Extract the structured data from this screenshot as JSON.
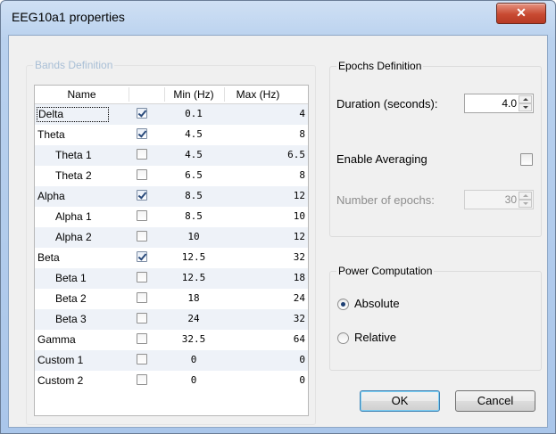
{
  "window": {
    "title": "EEG10a1 properties",
    "close_glyph": "✕"
  },
  "bands": {
    "group_label": "Bands Definition",
    "columns": {
      "name": "Name",
      "min": "Min (Hz)",
      "max": "Max (Hz)"
    },
    "rows": [
      {
        "name": "Delta",
        "checked": true,
        "min": "0.1",
        "max": "4",
        "sub": false
      },
      {
        "name": "Theta",
        "checked": true,
        "min": "4.5",
        "max": "8",
        "sub": false
      },
      {
        "name": "Theta 1",
        "checked": false,
        "min": "4.5",
        "max": "6.5",
        "sub": true
      },
      {
        "name": "Theta 2",
        "checked": false,
        "min": "6.5",
        "max": "8",
        "sub": true
      },
      {
        "name": "Alpha",
        "checked": true,
        "min": "8.5",
        "max": "12",
        "sub": false
      },
      {
        "name": "Alpha 1",
        "checked": false,
        "min": "8.5",
        "max": "10",
        "sub": true
      },
      {
        "name": "Alpha 2",
        "checked": false,
        "min": "10",
        "max": "12",
        "sub": true
      },
      {
        "name": "Beta",
        "checked": true,
        "min": "12.5",
        "max": "32",
        "sub": false
      },
      {
        "name": "Beta 1",
        "checked": false,
        "min": "12.5",
        "max": "18",
        "sub": true
      },
      {
        "name": "Beta 2",
        "checked": false,
        "min": "18",
        "max": "24",
        "sub": true
      },
      {
        "name": "Beta 3",
        "checked": false,
        "min": "24",
        "max": "32",
        "sub": true
      },
      {
        "name": "Gamma",
        "checked": false,
        "min": "32.5",
        "max": "64",
        "sub": false
      },
      {
        "name": "Custom 1",
        "checked": false,
        "min": "0",
        "max": "0",
        "sub": false
      },
      {
        "name": "Custom 2",
        "checked": false,
        "min": "0",
        "max": "0",
        "sub": false
      }
    ]
  },
  "epochs": {
    "group_label": "Epochs Definition",
    "duration_label": "Duration (seconds):",
    "duration_value": "4.0",
    "averaging_label": "Enable Averaging",
    "averaging_checked": false,
    "num_epochs_label": "Number of epochs:",
    "num_epochs_value": "30"
  },
  "power": {
    "group_label": "Power Computation",
    "absolute_label": "Absolute",
    "relative_label": "Relative",
    "selected": "Absolute"
  },
  "buttons": {
    "ok": "OK",
    "cancel": "Cancel"
  }
}
